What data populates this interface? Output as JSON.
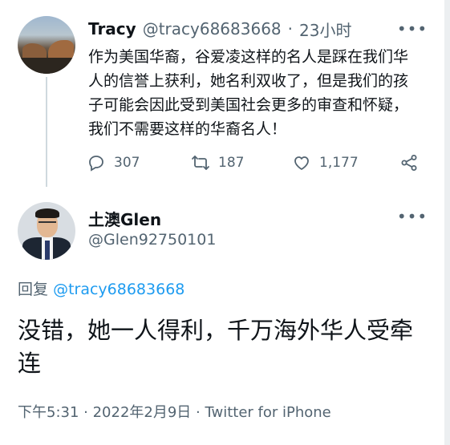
{
  "parent_tweet": {
    "display_name": "Tracy",
    "handle": "@tracy68683668",
    "separator": "·",
    "time_ago": "23小时",
    "more_icon": "more-horizontal-icon",
    "text": "作为美国华裔，谷爱凌这样的名人是踩在我们华人的信誉上获利，她名利双收了，但是我们的孩子可能会因此受到美国社会更多的审查和怀疑，我们不需要这样的华裔名人！",
    "actions": {
      "replies": "307",
      "retweets": "187",
      "likes": "1,177"
    }
  },
  "reply_tweet": {
    "display_name": "土澳Glen",
    "handle": "@Glen92750101",
    "more_icon": "more-horizontal-icon",
    "replying_to_label": "回复",
    "replying_to_handle": "@tracy68683668",
    "text": "没错，她一人得利，千万海外华人受牵连",
    "timestamp": "下午5:31 · 2022年2月9日 · Twitter for iPhone"
  },
  "colors": {
    "text_primary": "#0f1419",
    "text_secondary": "#536471",
    "link": "#1d9bf0",
    "thread_line": "#cfd9de"
  }
}
